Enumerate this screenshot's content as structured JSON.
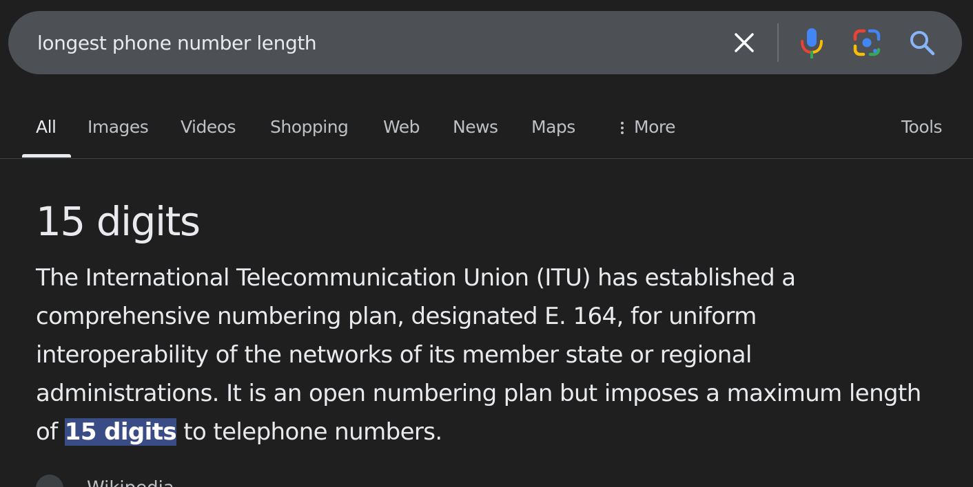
{
  "search": {
    "query": "longest phone number length"
  },
  "tabs": [
    {
      "label": "All",
      "active": true
    },
    {
      "label": "Images"
    },
    {
      "label": "Videos"
    },
    {
      "label": "Shopping"
    },
    {
      "label": "Web"
    },
    {
      "label": "News"
    },
    {
      "label": "Maps"
    },
    {
      "label": "More"
    }
  ],
  "tools_label": "Tools",
  "answer": {
    "title": "15 digits",
    "body_before": "The International Telecommunication Union (ITU) has established a comprehensive numbering plan, designated E. 164, for uniform interoperability of the networks of its member state or regional administrations. It is an open numbering plan but imposes a maximum length of ",
    "highlight": "15 digits",
    "body_after": " to telephone numbers."
  },
  "source": {
    "name": "Wikipedia"
  },
  "icons": {
    "clear": "close-icon",
    "mic": "microphone-icon",
    "lens": "google-lens-icon",
    "search": "search-icon",
    "more": "vertical-dots-icon"
  },
  "colors": {
    "background": "#1f1f1f",
    "search_bar": "#4d5156",
    "text": "#e8eaed",
    "muted_text": "#bdc1c6",
    "highlight": "#394c86",
    "mic_blue": "#4285f4",
    "mic_red": "#ea4335",
    "mic_yellow": "#fbbc04",
    "mic_green": "#34a853"
  }
}
